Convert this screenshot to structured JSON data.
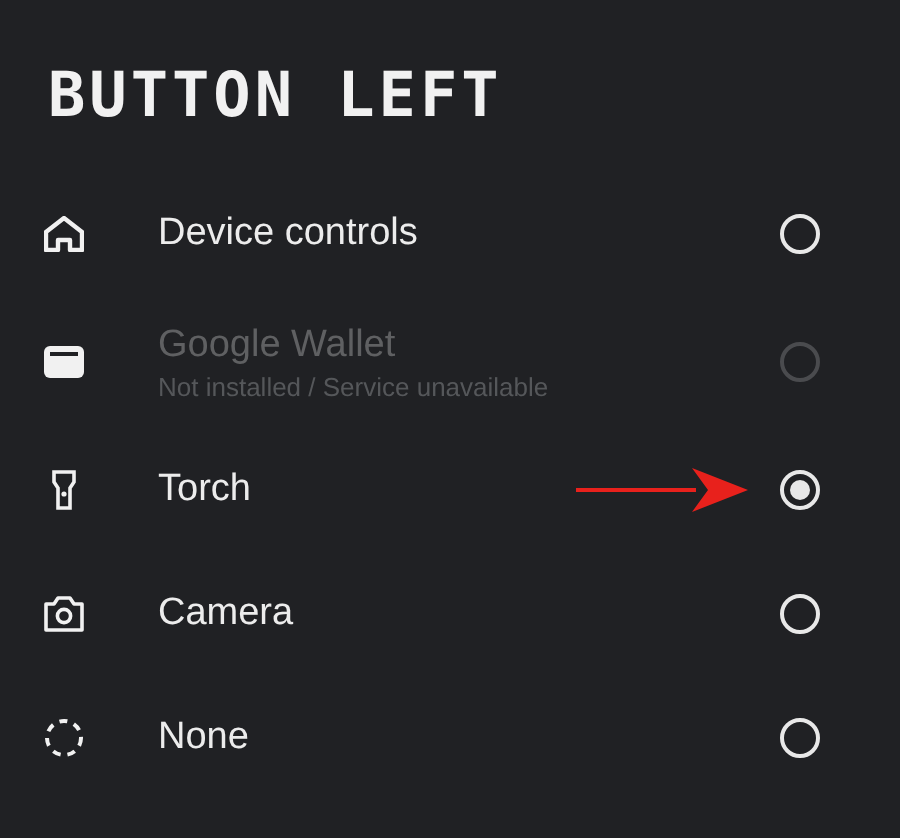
{
  "title": "BUTTON LEFT",
  "options": [
    {
      "kind": "home",
      "label": "Device controls",
      "disabled": false,
      "selected": false
    },
    {
      "kind": "wallet",
      "label": "Google Wallet",
      "subtitle": "Not installed / Service unavailable",
      "disabled": true,
      "selected": false
    },
    {
      "kind": "torch",
      "label": "Torch",
      "disabled": false,
      "selected": true,
      "annotated": true
    },
    {
      "kind": "camera",
      "label": "Camera",
      "disabled": false,
      "selected": false
    },
    {
      "kind": "none",
      "label": "None",
      "disabled": false,
      "selected": false
    }
  ]
}
